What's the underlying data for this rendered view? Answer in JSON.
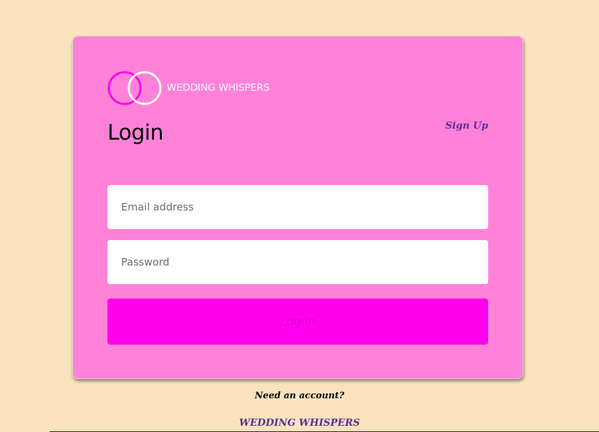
{
  "brand": {
    "name": "WEDDING WHISPERS",
    "logo_icon": "interlocking-rings-icon"
  },
  "login": {
    "title": "Login",
    "signup_link": "Sign Up",
    "email_placeholder": "Email address",
    "email_value": "",
    "password_placeholder": "Password",
    "password_value": "",
    "submit_label": "Log in"
  },
  "footer": {
    "need_account": "Need an account?",
    "brand": "WEDDING WHISPERS"
  },
  "colors": {
    "page_background": "#fae3bd",
    "card_background": "#ff82d8",
    "button_background": "#ff00ee",
    "button_text": "#d800c8",
    "link": "#5b3197",
    "ring_magenta": "#ff00ee",
    "ring_white": "#ffffff"
  }
}
